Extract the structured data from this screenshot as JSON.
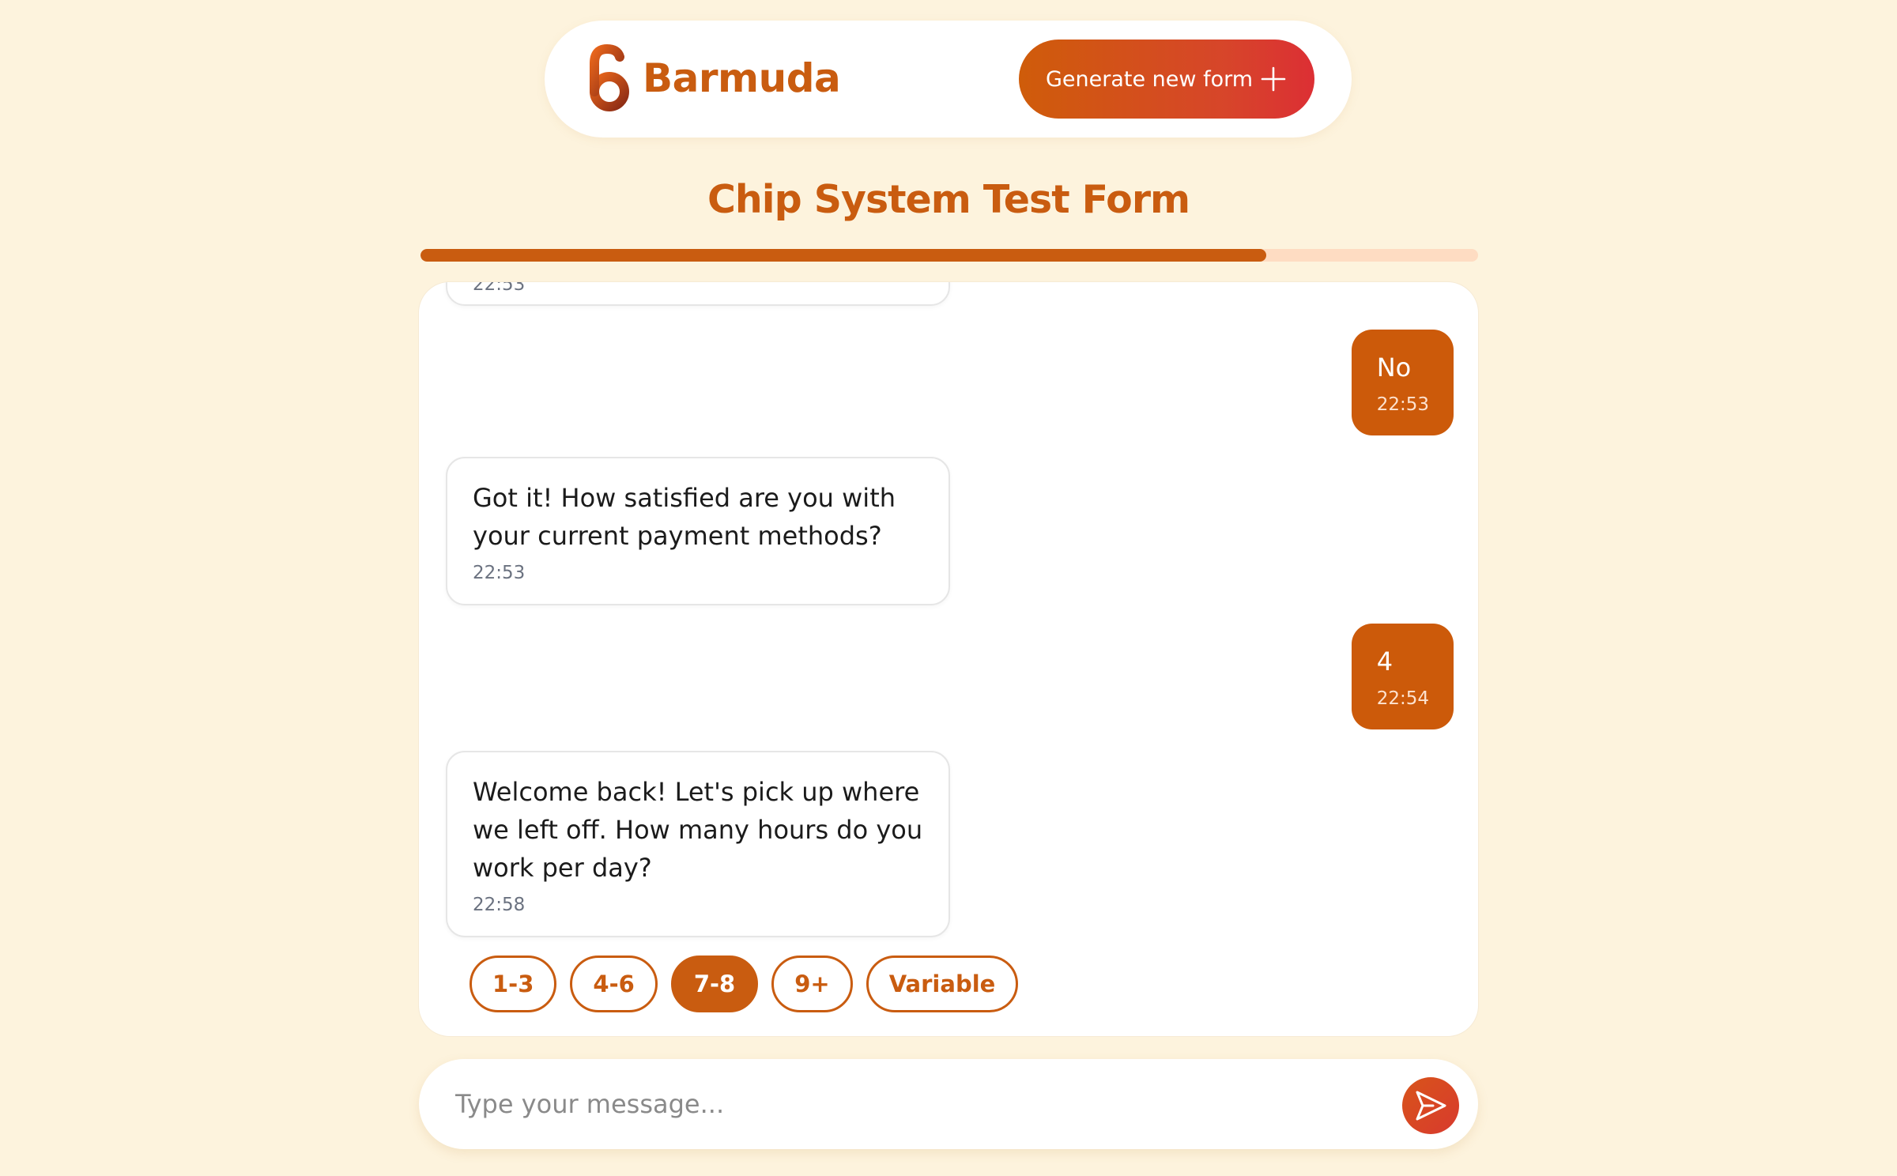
{
  "header": {
    "brand": "Barmuda",
    "generate_button_label": "Generate new form"
  },
  "form": {
    "title": "Chip System Test Form",
    "progress_fraction": 0.8
  },
  "messages": [
    {
      "sender": "bot",
      "text": "",
      "time": "22:53"
    },
    {
      "sender": "user",
      "text": "No",
      "time": "22:53"
    },
    {
      "sender": "bot",
      "text": "Got it! How satisfied are you with your current payment methods?",
      "time": "22:53"
    },
    {
      "sender": "user",
      "text": "4",
      "time": "22:54"
    },
    {
      "sender": "bot",
      "text": "Welcome back! Let's pick up where we left off. How many hours do you work per day?",
      "time": "22:58"
    }
  ],
  "quick_replies": [
    {
      "label": "1-3",
      "selected": false
    },
    {
      "label": "4-6",
      "selected": false
    },
    {
      "label": "7-8",
      "selected": true
    },
    {
      "label": "9+",
      "selected": false
    },
    {
      "label": "Variable",
      "selected": false
    }
  ],
  "composer": {
    "placeholder": "Type your message...",
    "value": ""
  },
  "icons": {
    "logo": "barmuda-logo-icon",
    "plus": "plus-icon",
    "send": "send-icon"
  },
  "colors": {
    "brand": "#c95c10",
    "background": "#fdf3dd",
    "gradient_end": "#dc2f34",
    "progress_track": "#fedcc2"
  }
}
